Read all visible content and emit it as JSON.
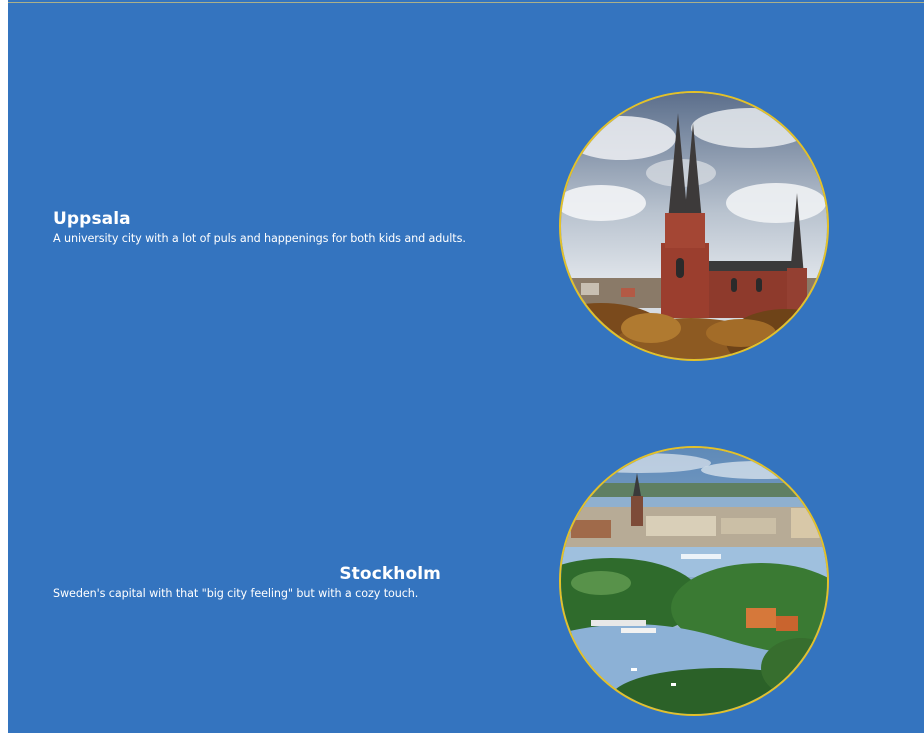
{
  "cities": [
    {
      "name": "Uppsala",
      "description": "A university city with a lot of puls and happenings for both kids and adults.",
      "image_subject": "cathedral-photo"
    },
    {
      "name": "Stockholm",
      "description": "Sweden's capital with that \"big city feeling\" but with a cozy touch.",
      "image_subject": "city-archipelago-photo"
    }
  ],
  "colors": {
    "background": "#3474bf",
    "text": "#ffffff",
    "photo_border": "#e3c12a"
  }
}
